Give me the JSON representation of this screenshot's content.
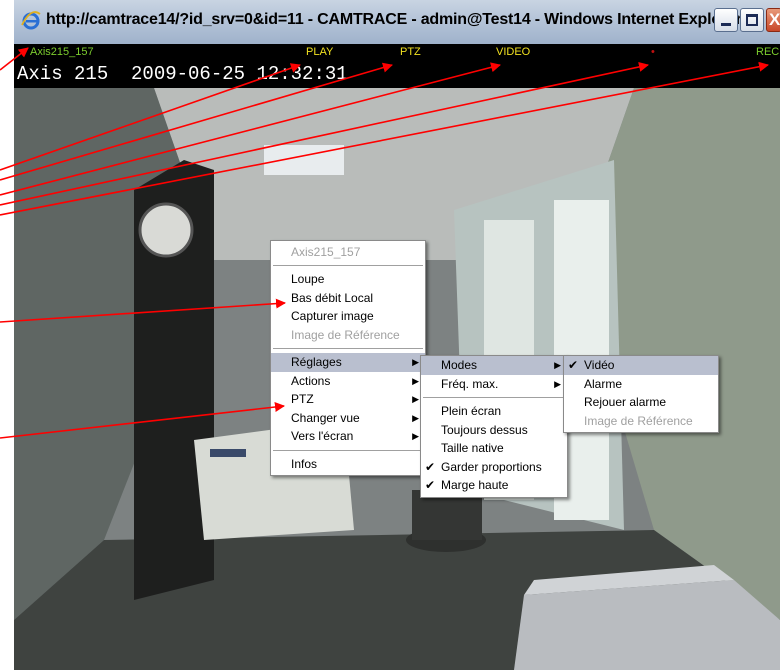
{
  "window": {
    "title": "http://camtrace14/?id_srv=0&id=11 - CAMTRACE - admin@Test14 - Windows Internet Explorer",
    "close_glyph": "X"
  },
  "camera_toolbar": {
    "camera_name": "Axis215_157",
    "play": "PLAY",
    "ptz": "PTZ",
    "video": "VIDEO",
    "indicator": "•",
    "rec": "REC"
  },
  "osd": {
    "text": "Axis 215  2009-06-25 12:32:31"
  },
  "context_menu": {
    "header": "Axis215_157",
    "items": [
      {
        "label": "Loupe"
      },
      {
        "label": "Bas débit Local"
      },
      {
        "label": "Capturer image"
      },
      {
        "label": "Image de Référence"
      },
      {
        "label": "Réglages"
      },
      {
        "label": "Actions"
      },
      {
        "label": "PTZ"
      },
      {
        "label": "Changer vue"
      },
      {
        "label": "Vers l'écran"
      },
      {
        "label": "Infos"
      }
    ]
  },
  "reglages_menu": {
    "items": [
      {
        "label": "Modes"
      },
      {
        "label": "Fréq. max."
      },
      {
        "label": "Plein écran"
      },
      {
        "label": "Toujours dessus"
      },
      {
        "label": "Taille native"
      },
      {
        "label": "Garder proportions"
      },
      {
        "label": "Marge haute"
      }
    ]
  },
  "modes_menu": {
    "items": [
      {
        "label": "Vidéo"
      },
      {
        "label": "Alarme"
      },
      {
        "label": "Rejouer alarme"
      },
      {
        "label": "Image de Référence"
      }
    ]
  },
  "icons": {
    "submenu_arrow": "▶",
    "check": "✔"
  },
  "colors": {
    "cam_name": "#7ccd2e",
    "toolbar_label": "#f0e020",
    "indicator": "#c01010",
    "arrow": "#ff0000",
    "menu_highlight": "#b9bfcf"
  }
}
